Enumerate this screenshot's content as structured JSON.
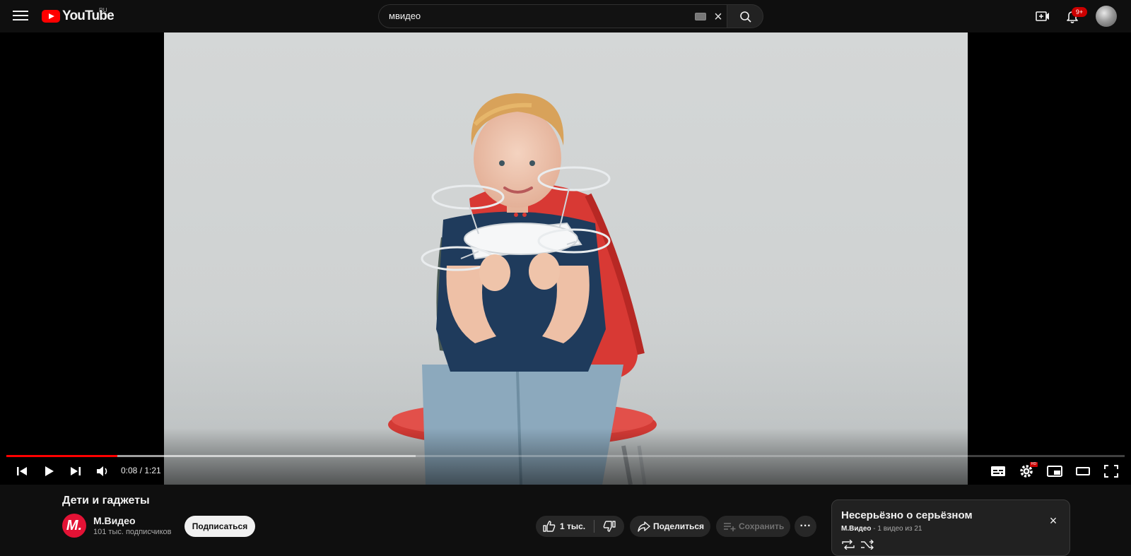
{
  "header": {
    "logo_text": "YouTube",
    "country_code": "RU",
    "search_value": "мвидео",
    "notifications_count": "9+"
  },
  "player": {
    "current_time": "0:08",
    "duration": "1:21",
    "time_separator": " / ",
    "progress_fraction": 0.099,
    "buffered_fraction": 0.366,
    "hd_label": "HD"
  },
  "video": {
    "title": "Дети и гаджеты",
    "channel": {
      "name": "М.Видео",
      "logo_text": "М.",
      "subscribers": "101 тыс. подписчиков",
      "subscribe_label": "Подписаться"
    },
    "actions": {
      "likes": "1 тыс.",
      "share_label": "Поделиться",
      "save_label": "Сохранить",
      "more_label": "···"
    }
  },
  "playlist": {
    "title": "Несерьёзно о серьёзном",
    "channel": "М.Видео",
    "separator": " - ",
    "position": "1 видео из 21"
  },
  "colors": {
    "accent": "#ff0000",
    "background": "#0f0f0f",
    "badge": "#cc0000",
    "brand_logo": "#e31235"
  },
  "icons": [
    "menu-icon",
    "youtube-logo-icon",
    "keyboard-icon",
    "close-icon",
    "search-icon",
    "create-video-icon",
    "bell-icon",
    "previous-icon",
    "play-icon",
    "next-icon",
    "volume-icon",
    "subtitles-icon",
    "settings-icon",
    "miniplayer-icon",
    "theater-mode-icon",
    "fullscreen-icon",
    "thumbs-up-icon",
    "thumbs-down-icon",
    "share-icon",
    "playlist-add-icon",
    "more-icon",
    "loop-icon",
    "shuffle-icon"
  ]
}
